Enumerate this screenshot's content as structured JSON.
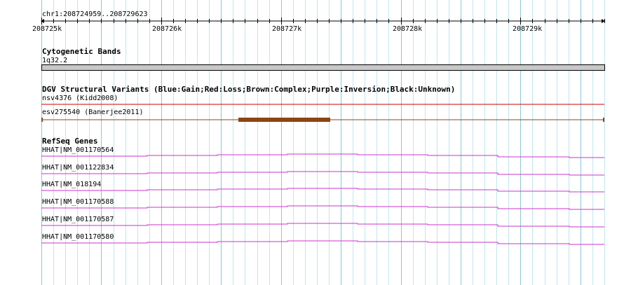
{
  "ruler": {
    "range_label": "chr1:208724959..208729623",
    "ticks": [
      "208725k",
      "208726k",
      "208727k",
      "208728k",
      "208729k"
    ]
  },
  "tracks": {
    "cytoband": {
      "title": "Cytogenetic Bands",
      "feature_label": "1q32.2"
    },
    "dgv": {
      "title": "DGV Structural Variants (Blue:Gain;Red:Loss;Brown:Complex;Purple:Inversion;Black:Unknown)",
      "features": [
        {
          "label": "nsv4376 (Kidd2008)",
          "color": "#cc0000"
        },
        {
          "label": "esv275540 (Banerjee2011)",
          "color": "#8b4513"
        }
      ]
    },
    "refseq": {
      "title": "RefSeq Genes",
      "color": "#cc33cc",
      "genes": [
        "HHAT|NM_001170564",
        "HHAT|NM_001122834",
        "HHAT|NM_018194",
        "HHAT|NM_001170588",
        "HHAT|NM_001170587",
        "HHAT|NM_001170580"
      ]
    }
  },
  "colors": {
    "grid": "#bfe6ef",
    "grid_major": "#88c9d9",
    "cytoband_fill": "#c8c8c8"
  }
}
